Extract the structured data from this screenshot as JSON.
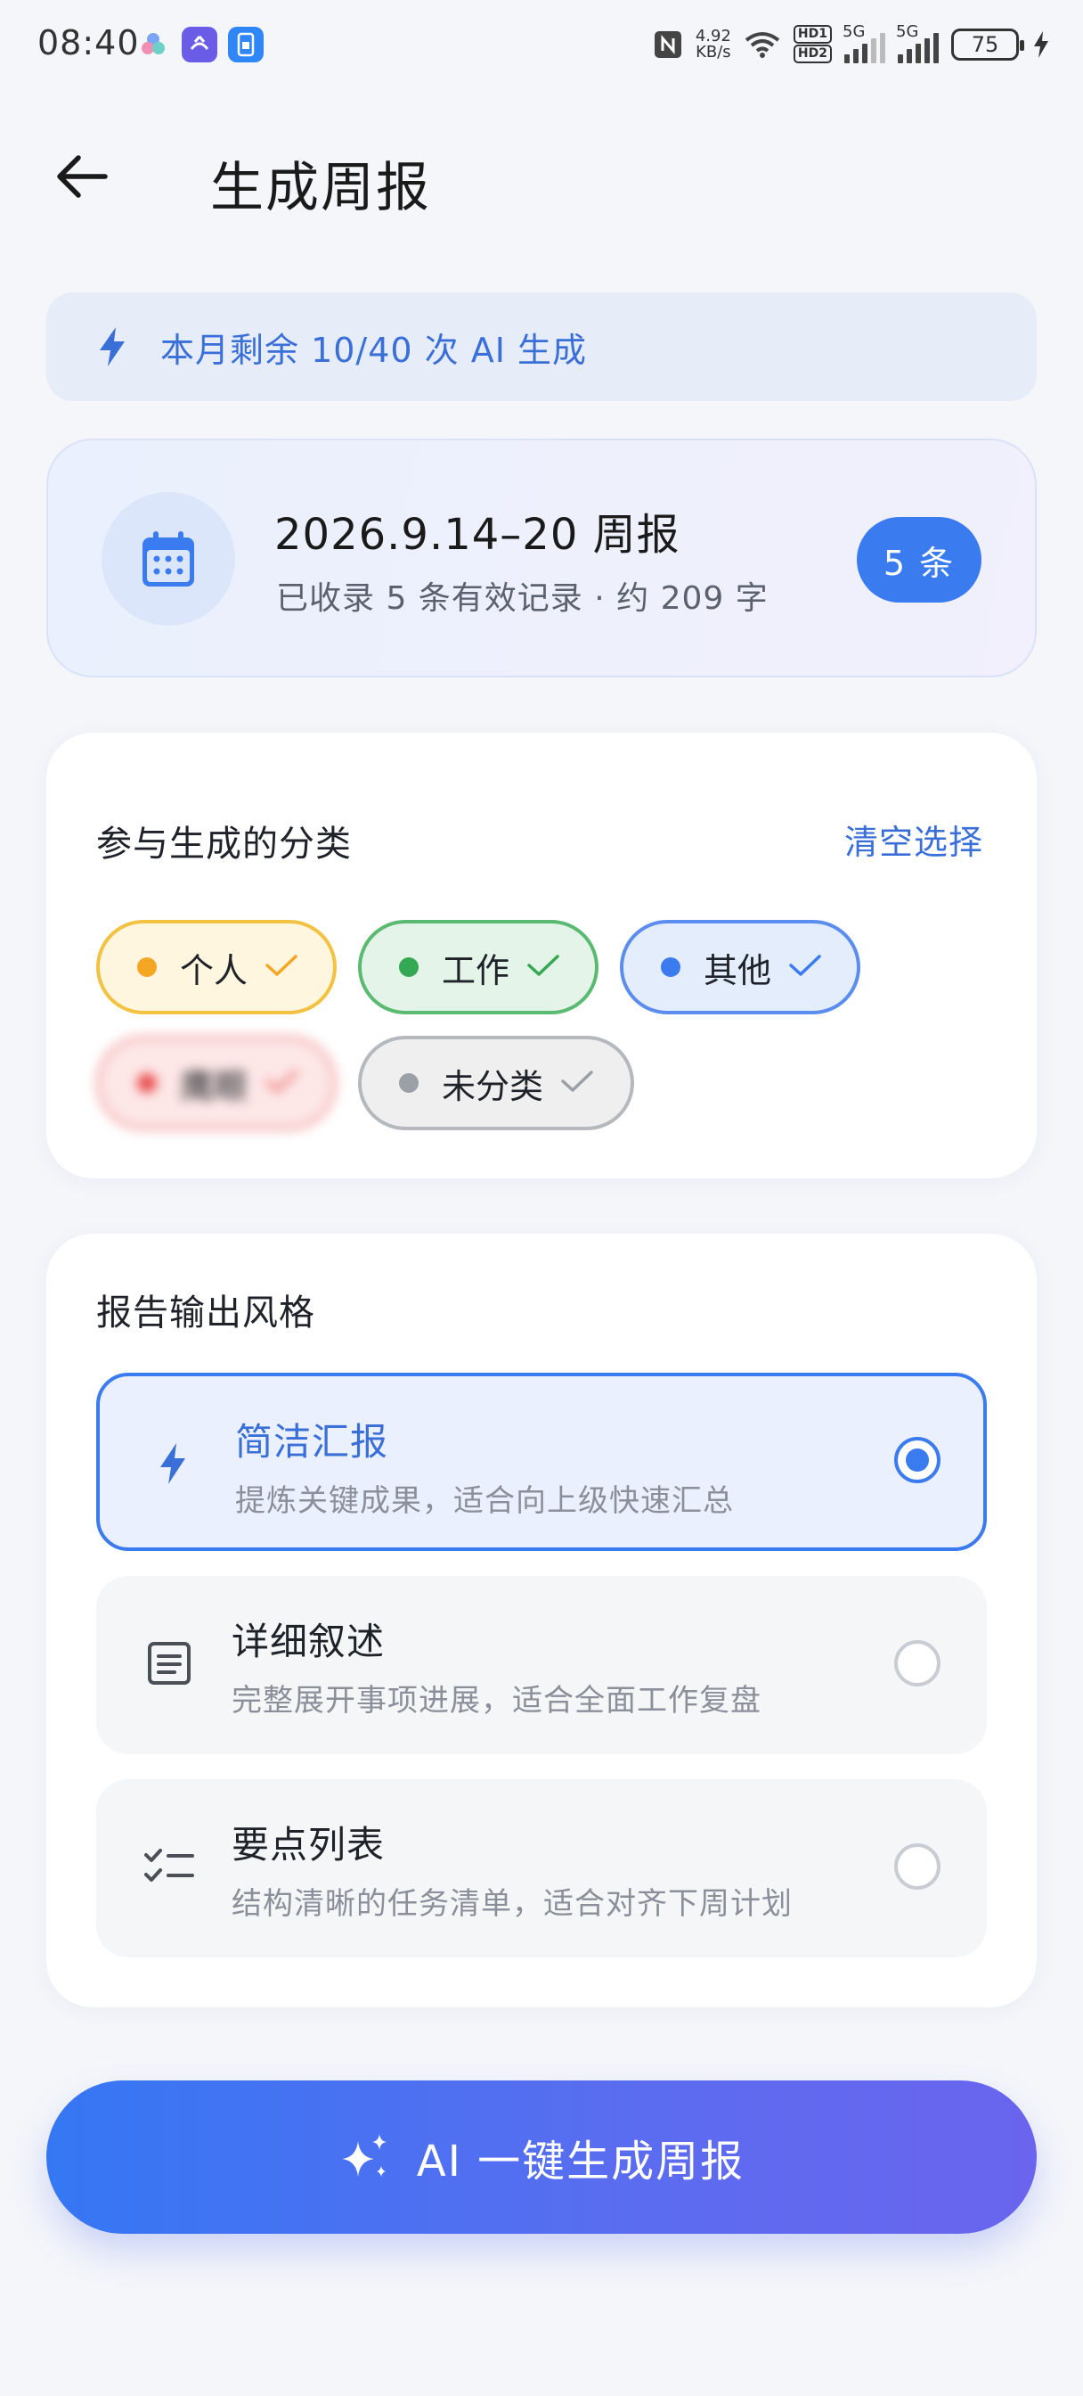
{
  "status_bar": {
    "time": "08:40",
    "net_speed_value": "4.92",
    "net_speed_unit": "KB/s",
    "hd_badge_1": "HD1",
    "hd_badge_2": "HD2",
    "signal_1_label": "5G",
    "signal_2_label": "5G",
    "battery": "75"
  },
  "header": {
    "title": "生成周报"
  },
  "quota": {
    "text": "本月剩余 10/40 次 AI 生成"
  },
  "week": {
    "title": "2026.9.14–20 周报",
    "subtitle": "已收录 5 条有效记录 · 约 209 字",
    "count": "5 条"
  },
  "categories": {
    "title": "参与生成的分类",
    "clear_label": "清空选择",
    "chips": [
      {
        "label": "个人",
        "color": "#f5a623",
        "bg": "#fff6df",
        "border": "#f3c242"
      },
      {
        "label": "工作",
        "color": "#34a853",
        "bg": "#e4f4e8",
        "border": "#5bba72"
      },
      {
        "label": "其他",
        "color": "#3b7bf0",
        "bg": "#e4edfc",
        "border": "#5b8def"
      },
      {
        "label": "鹰眼",
        "color": "#e94b4b",
        "bg": "#fde7e7",
        "border": "#f29c9c"
      },
      {
        "label": "未分类",
        "color": "#9aa0a6",
        "bg": "#efefef",
        "border": "#b5b8bd"
      }
    ]
  },
  "style": {
    "title": "报告输出风格",
    "options": [
      {
        "title": "简洁汇报",
        "desc": "提炼关键成果，适合向上级快速汇总",
        "icon": "bolt-icon",
        "selected": true
      },
      {
        "title": "详细叙述",
        "desc": "完整展开事项进展，适合全面工作复盘",
        "icon": "document-icon",
        "selected": false
      },
      {
        "title": "要点列表",
        "desc": "结构清晰的任务清单，适合对齐下周计划",
        "icon": "checklist-icon",
        "selected": false
      }
    ]
  },
  "generate": {
    "label": "AI 一键生成周报"
  },
  "colors": {
    "accent": "#3b7bf0",
    "background": "#f5f6fa"
  }
}
